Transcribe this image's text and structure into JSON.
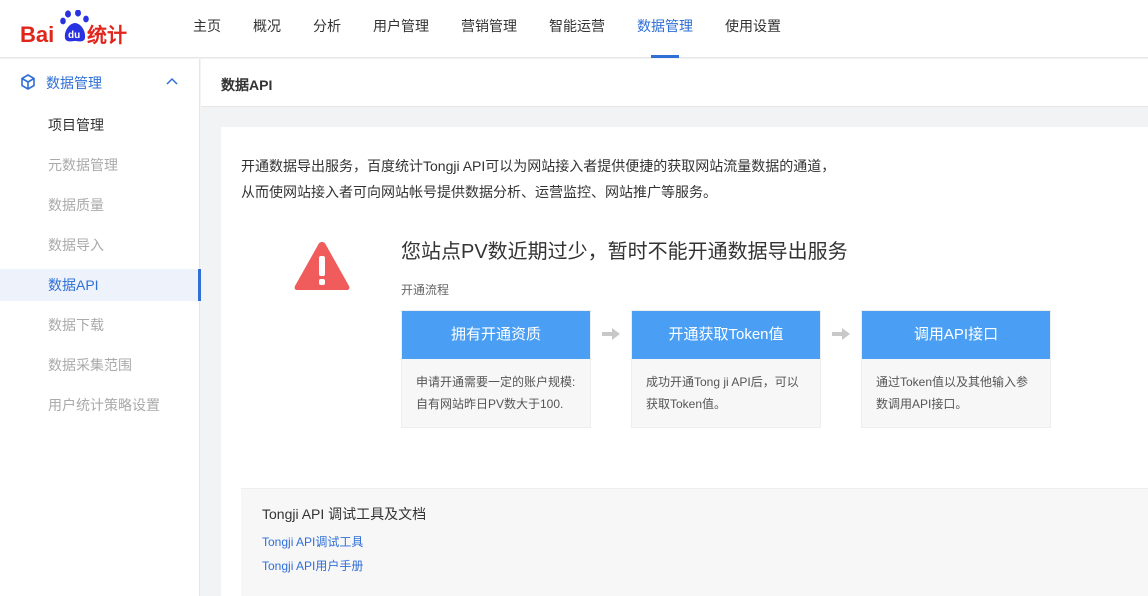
{
  "brand": {
    "logo_text_bai": "Bai",
    "logo_text_du": "du",
    "logo_text_suffix": "统计"
  },
  "nav": {
    "items": [
      "主页",
      "概况",
      "分析",
      "用户管理",
      "营销管理",
      "智能运营",
      "数据管理",
      "使用设置"
    ],
    "active": "数据管理"
  },
  "sidebar": {
    "group_title": "数据管理",
    "items": [
      "项目管理",
      "元数据管理",
      "数据质量",
      "数据导入",
      "数据API",
      "数据下载",
      "数据采集范围",
      "用户统计策略设置"
    ],
    "active": "数据API"
  },
  "page": {
    "title": "数据API"
  },
  "intro": {
    "line1": "开通数据导出服务，百度统计Tongji API可以为网站接入者提供便捷的获取网站流量数据的通道，",
    "line2": "从而使网站接入者可向网站帐号提供数据分析、运营监控、网站推广等服务。"
  },
  "warning": {
    "title": "您站点PV数近期过少，暂时不能开通数据导出服务",
    "flow_label": "开通流程"
  },
  "steps": [
    {
      "title": "拥有开通资质",
      "desc1": "申请开通需要一定的账户规模:",
      "desc2": "自有网站昨日PV数大于100."
    },
    {
      "title": "开通获取Token值",
      "desc1": "成功开通Tong ji API后，可以",
      "desc2": "获取Token值。"
    },
    {
      "title": "调用API接口",
      "desc1": "通过Token值以及其他输入参",
      "desc2": "数调用API接口。"
    }
  ],
  "tools": {
    "title": "Tongji API 调试工具及文档",
    "link1": "Tongji API调试工具",
    "link2": "Tongji API用户手册"
  },
  "colors": {
    "accent": "#2f6fd6",
    "step_header": "#4a9ff5",
    "warning": "#f05b5b",
    "logo_red": "#e1251b",
    "logo_blue": "#2932e1"
  }
}
